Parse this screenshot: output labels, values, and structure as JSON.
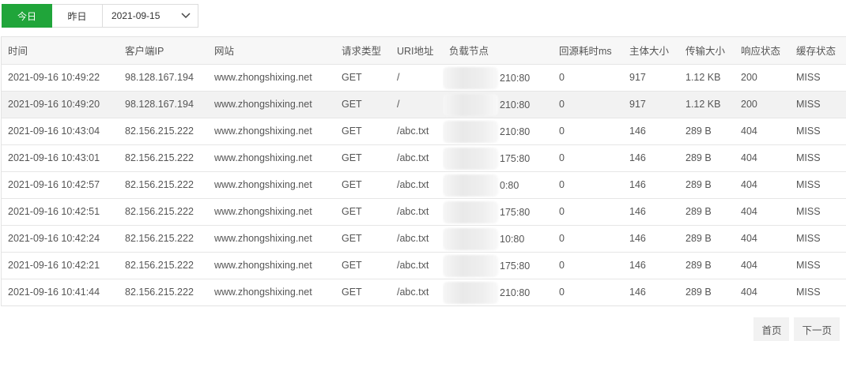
{
  "toolbar": {
    "today_label": "今日",
    "yesterday_label": "昨日",
    "date_value": "2021-09-15",
    "accent_color": "#20a53a"
  },
  "table": {
    "columns": [
      "时间",
      "客户端IP",
      "网站",
      "请求类型",
      "URI地址",
      "负载节点",
      "回源耗时ms",
      "主体大小",
      "传输大小",
      "响应状态",
      "缓存状态"
    ],
    "rows": [
      [
        "2021-09-16 10:49:22",
        "98.128.167.194",
        "www.zhongshixing.net",
        "GET",
        "/",
        "210:80",
        "0",
        "917",
        "1.12 KB",
        "200",
        "MISS"
      ],
      [
        "2021-09-16 10:49:20",
        "98.128.167.194",
        "www.zhongshixing.net",
        "GET",
        "/",
        "210:80",
        "0",
        "917",
        "1.12 KB",
        "200",
        "MISS"
      ],
      [
        "2021-09-16 10:43:04",
        "82.156.215.222",
        "www.zhongshixing.net",
        "GET",
        "/abc.txt",
        "210:80",
        "0",
        "146",
        "289 B",
        "404",
        "MISS"
      ],
      [
        "2021-09-16 10:43:01",
        "82.156.215.222",
        "www.zhongshixing.net",
        "GET",
        "/abc.txt",
        "175:80",
        "0",
        "146",
        "289 B",
        "404",
        "MISS"
      ],
      [
        "2021-09-16 10:42:57",
        "82.156.215.222",
        "www.zhongshixing.net",
        "GET",
        "/abc.txt",
        "0:80",
        "0",
        "146",
        "289 B",
        "404",
        "MISS"
      ],
      [
        "2021-09-16 10:42:51",
        "82.156.215.222",
        "www.zhongshixing.net",
        "GET",
        "/abc.txt",
        "175:80",
        "0",
        "146",
        "289 B",
        "404",
        "MISS"
      ],
      [
        "2021-09-16 10:42:24",
        "82.156.215.222",
        "www.zhongshixing.net",
        "GET",
        "/abc.txt",
        "10:80",
        "0",
        "146",
        "289 B",
        "404",
        "MISS"
      ],
      [
        "2021-09-16 10:42:21",
        "82.156.215.222",
        "www.zhongshixing.net",
        "GET",
        "/abc.txt",
        "175:80",
        "0",
        "146",
        "289 B",
        "404",
        "MISS"
      ],
      [
        "2021-09-16 10:41:44",
        "82.156.215.222",
        "www.zhongshixing.net",
        "GET",
        "/abc.txt",
        "210:80",
        "0",
        "146",
        "289 B",
        "404",
        "MISS"
      ]
    ]
  },
  "pager": {
    "first_label": "首页",
    "next_label": "下一页"
  },
  "icons": {
    "date_dropdown": "chevron-down-icon"
  }
}
